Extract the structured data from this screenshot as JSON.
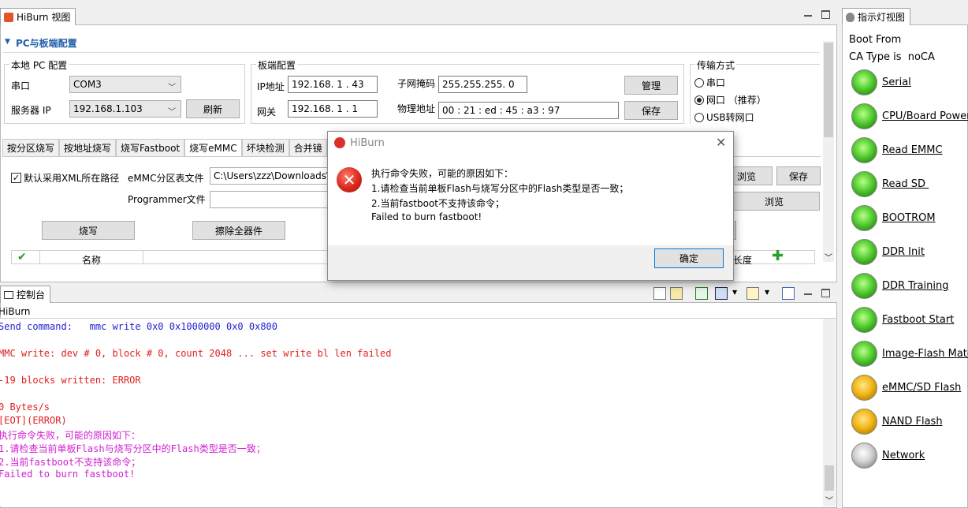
{
  "left_view": {
    "tab_title": "HiBurn 视图"
  },
  "section": {
    "title": "PC与板端配置"
  },
  "local_pc": {
    "group_label": "本地 PC 配置",
    "port_label": "串口",
    "port_value": "COM3",
    "server_ip_label": "服务器 IP",
    "server_ip_value": "192.168.1.103",
    "refresh_button": "刷新"
  },
  "board": {
    "group_label": "板端配置",
    "ip_label": "IP地址",
    "ip_value": "192.168. 1 . 43",
    "gateway_label": "网关",
    "gateway_value": "192.168. 1 . 1",
    "mask_label": "子网掩码",
    "mask_value": "255.255.255. 0",
    "mac_label": "物理地址",
    "mac_value": "00 : 21 : ed : 45 : a3 : 97",
    "manage_button": "管理",
    "save_button": "保存"
  },
  "transfer": {
    "group_label": "传输方式",
    "options": [
      "串口",
      "网口 （推荐）",
      "USB转网口"
    ],
    "selected": "网口 （推荐）"
  },
  "tabs": [
    "按分区烧写",
    "按地址烧写",
    "烧写Fastboot",
    "烧写eMMC",
    "坏块检测",
    "合并镜"
  ],
  "active_tab": "烧写eMMC",
  "emmc": {
    "xml_checkbox_label": "默认采用XML所在路径",
    "partition_label": "eMMC分区表文件",
    "partition_value": "C:\\Users\\zzz\\Downloads\\",
    "browse_button": "浏览",
    "save_button": "保存",
    "programmer_label": "Programmer文件",
    "browse2_button": "浏览",
    "burn_button": "烧写",
    "erase_button": "擦除全器件",
    "table_col_name": "名称",
    "table_col_len": "长度"
  },
  "console": {
    "tab_title": "控制台",
    "subtitle": "HiBurn",
    "lines": [
      {
        "text": "Send command:   mmc write 0x0 0x1000000 0x0 0x800",
        "color": "#1f1fd0"
      },
      {
        "text": "MMC write: dev # 0, block # 0, count 2048 ... set write bl len failed",
        "color": "#e02020"
      },
      {
        "text": "-19 blocks written: ERROR",
        "color": "#e02020"
      },
      {
        "text": "0 Bytes/s",
        "color": "#e02020"
      },
      {
        "text": "[EOT](ERROR)",
        "color": "#e02020"
      },
      {
        "text": "执行命令失败，可能的原因如下：",
        "color": "#d020d0"
      },
      {
        "text": "1.请检查当前单板Flash与烧写分区中的Flash类型是否一致；",
        "color": "#d020d0"
      },
      {
        "text": "2.当前fastboot不支持该命令；",
        "color": "#d020d0"
      },
      {
        "text": "Failed to burn fastboot!",
        "color": "#d020d0"
      }
    ]
  },
  "indicator_view": {
    "tab_title": "指示灯视图",
    "boot_from": "Boot From",
    "ca_type": "CA Type is  noCA",
    "lights": [
      {
        "label": "Serial",
        "color": "green"
      },
      {
        "label": "CPU/Board Power-",
        "color": "green"
      },
      {
        "label": "Read EMMC",
        "color": "green"
      },
      {
        "label": "Read SD ",
        "color": "green"
      },
      {
        "label": "BOOTROM",
        "color": "green"
      },
      {
        "label": "DDR Init",
        "color": "green"
      },
      {
        "label": "DDR Training",
        "color": "green"
      },
      {
        "label": "Fastboot Start",
        "color": "green"
      },
      {
        "label": "Image-Flash Match",
        "color": "green"
      },
      {
        "label": "eMMC/SD Flash",
        "color": "yellow"
      },
      {
        "label": "NAND Flash",
        "color": "yellow"
      },
      {
        "label": "Network",
        "color": "gray"
      }
    ]
  },
  "dialog": {
    "title": "HiBurn",
    "messages": [
      "执行命令失败，可能的原因如下：",
      "1.请检查当前单板Flash与烧写分区中的Flash类型是否一致；",
      "2.当前fastboot不支持该命令；",
      "Failed to burn fastboot!"
    ],
    "ok_button": "确定"
  }
}
